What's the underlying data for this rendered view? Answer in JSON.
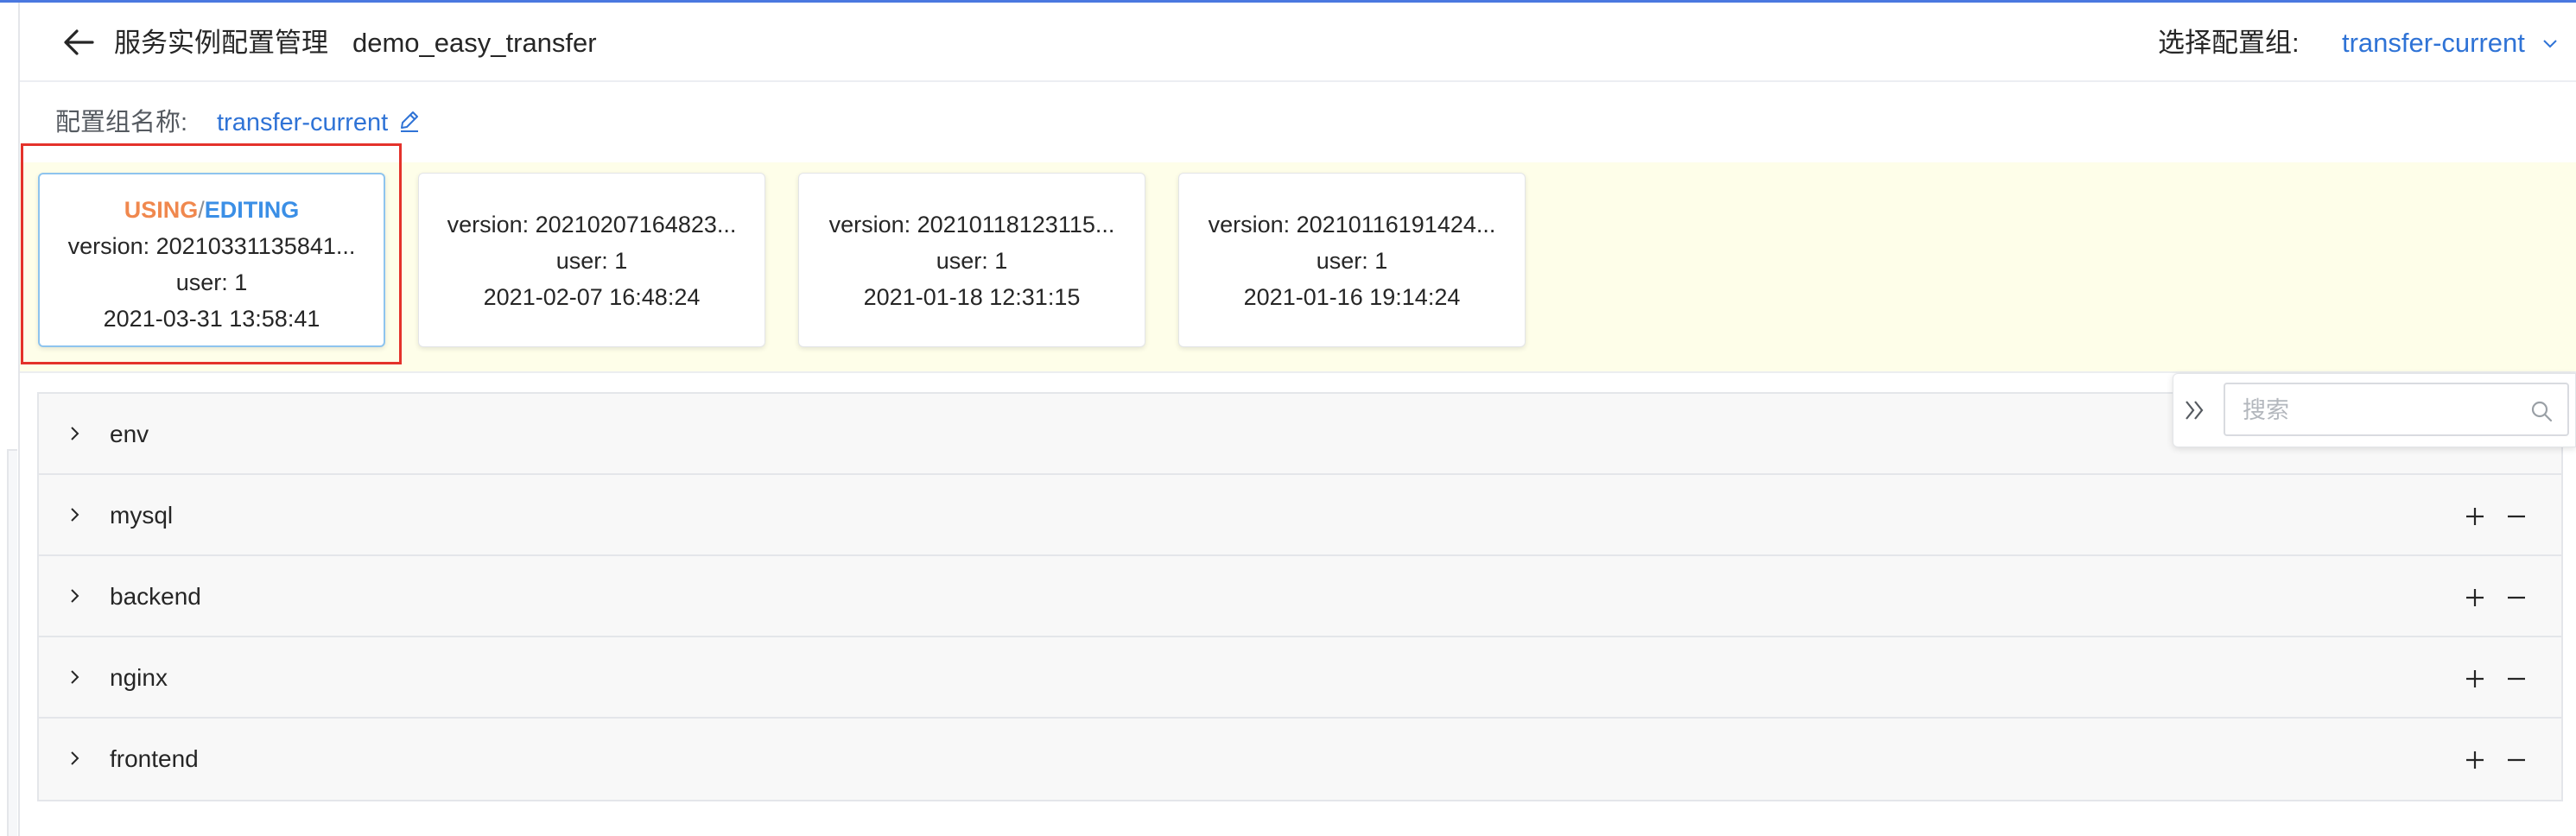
{
  "header": {
    "title": "服务实例配置管理",
    "instance_name": "demo_easy_transfer",
    "group_select_label": "选择配置组:",
    "group_select_value": "transfer-current",
    "icons": {
      "back": "arrow-left-icon",
      "dropdown": "chevron-down-icon"
    }
  },
  "group": {
    "name_label": "配置组名称:",
    "name_value": "transfer-current",
    "edit_icon": "edit-icon"
  },
  "versions": [
    {
      "status_using": "USING",
      "status_sep": "/",
      "status_editing": "EDITING",
      "version": "version: 20210331135841...",
      "user": "user: 1",
      "time": "2021-03-31 13:58:41"
    },
    {
      "version": "version: 20210207164823...",
      "user": "user: 1",
      "time": "2021-02-07 16:48:24"
    },
    {
      "version": "version: 20210118123115...",
      "user": "user: 1",
      "time": "2021-01-18 12:31:15"
    },
    {
      "version": "version: 20210116191424...",
      "user": "user: 1",
      "time": "2021-01-16 19:14:24"
    }
  ],
  "panels": [
    {
      "name": "env"
    },
    {
      "name": "mysql"
    },
    {
      "name": "backend"
    },
    {
      "name": "nginx"
    },
    {
      "name": "frontend"
    }
  ],
  "search": {
    "placeholder": "搜索",
    "value": "",
    "icons": {
      "expand": "double-chevron-right-icon",
      "search": "search-icon"
    }
  },
  "colors": {
    "accent": "#2f73d6",
    "using": "#f0884e",
    "editing": "#3b8fe6",
    "highlight": "#e4322b",
    "strip_bg": "#fefee9"
  }
}
